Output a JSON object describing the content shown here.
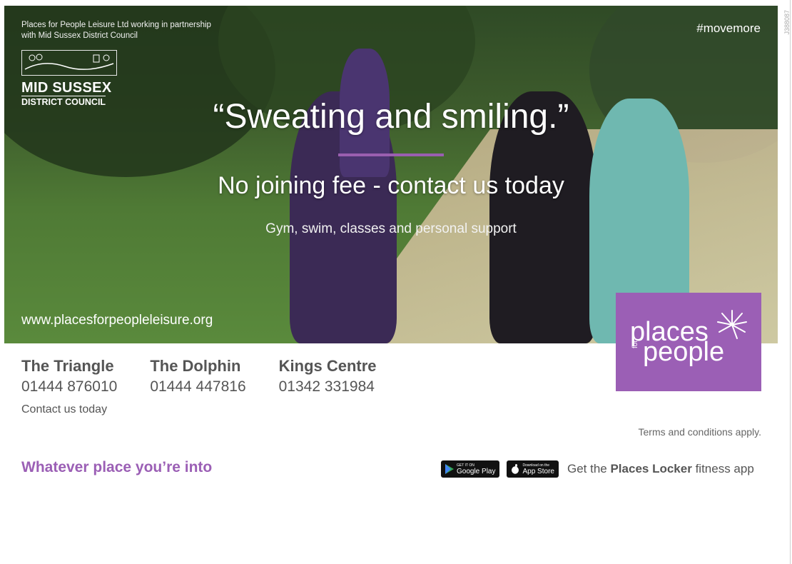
{
  "hero": {
    "partnership": "Places for People Leisure Ltd working in partnership with Mid Sussex District Council",
    "council_name": "MID SUSSEX",
    "council_sub": "DISTRICT COUNCIL",
    "hashtag": "#movemore",
    "headline": "“Sweating and smiling.”",
    "subhead": "No joining fee - contact us today",
    "tagline": "Gym, swim, classes and personal support",
    "url": "www.placesforpeopleleisure.org"
  },
  "brand": {
    "line1": "places",
    "for": "for",
    "line2": "people",
    "color": "#9b5fb5"
  },
  "venues": [
    {
      "name": "The Triangle",
      "phone": "01444 876010"
    },
    {
      "name": "The Dolphin",
      "phone": "01444 447816"
    },
    {
      "name": "Kings Centre",
      "phone": "01342 331984"
    }
  ],
  "contact": "Contact us today",
  "terms": "Terms and conditions apply.",
  "slogan": "Whatever place you’re into",
  "app": {
    "google_small": "GET IT ON",
    "google_big": "Google Play",
    "apple_small": "Download on the",
    "apple_big": "App Store",
    "prefix": "Get the",
    "name": "Places Locker",
    "suffix": "fitness app"
  },
  "code": "J388087"
}
